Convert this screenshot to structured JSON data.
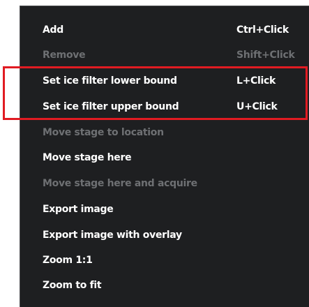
{
  "context_menu": {
    "items": [
      {
        "label": "Add",
        "shortcut": "Ctrl+Click",
        "enabled": true
      },
      {
        "label": "Remove",
        "shortcut": "Shift+Click",
        "enabled": false
      },
      {
        "label": "Set ice filter lower bound",
        "shortcut": "L+Click",
        "enabled": true
      },
      {
        "label": "Set ice filter upper bound",
        "shortcut": "U+Click",
        "enabled": true
      },
      {
        "label": "Move stage to location",
        "shortcut": "",
        "enabled": false
      },
      {
        "label": "Move stage here",
        "shortcut": "",
        "enabled": true
      },
      {
        "label": "Move stage here and acquire",
        "shortcut": "",
        "enabled": false
      },
      {
        "label": "Export image",
        "shortcut": "",
        "enabled": true
      },
      {
        "label": "Export image with overlay",
        "shortcut": "",
        "enabled": true
      },
      {
        "label": "Zoom 1:1",
        "shortcut": "",
        "enabled": true
      },
      {
        "label": "Zoom to fit",
        "shortcut": "",
        "enabled": true
      }
    ]
  },
  "colors": {
    "menu_background": "#1e1f21",
    "enabled_text": "#ffffff",
    "disabled_text": "#6e7073",
    "highlight_border": "#e11b22"
  }
}
